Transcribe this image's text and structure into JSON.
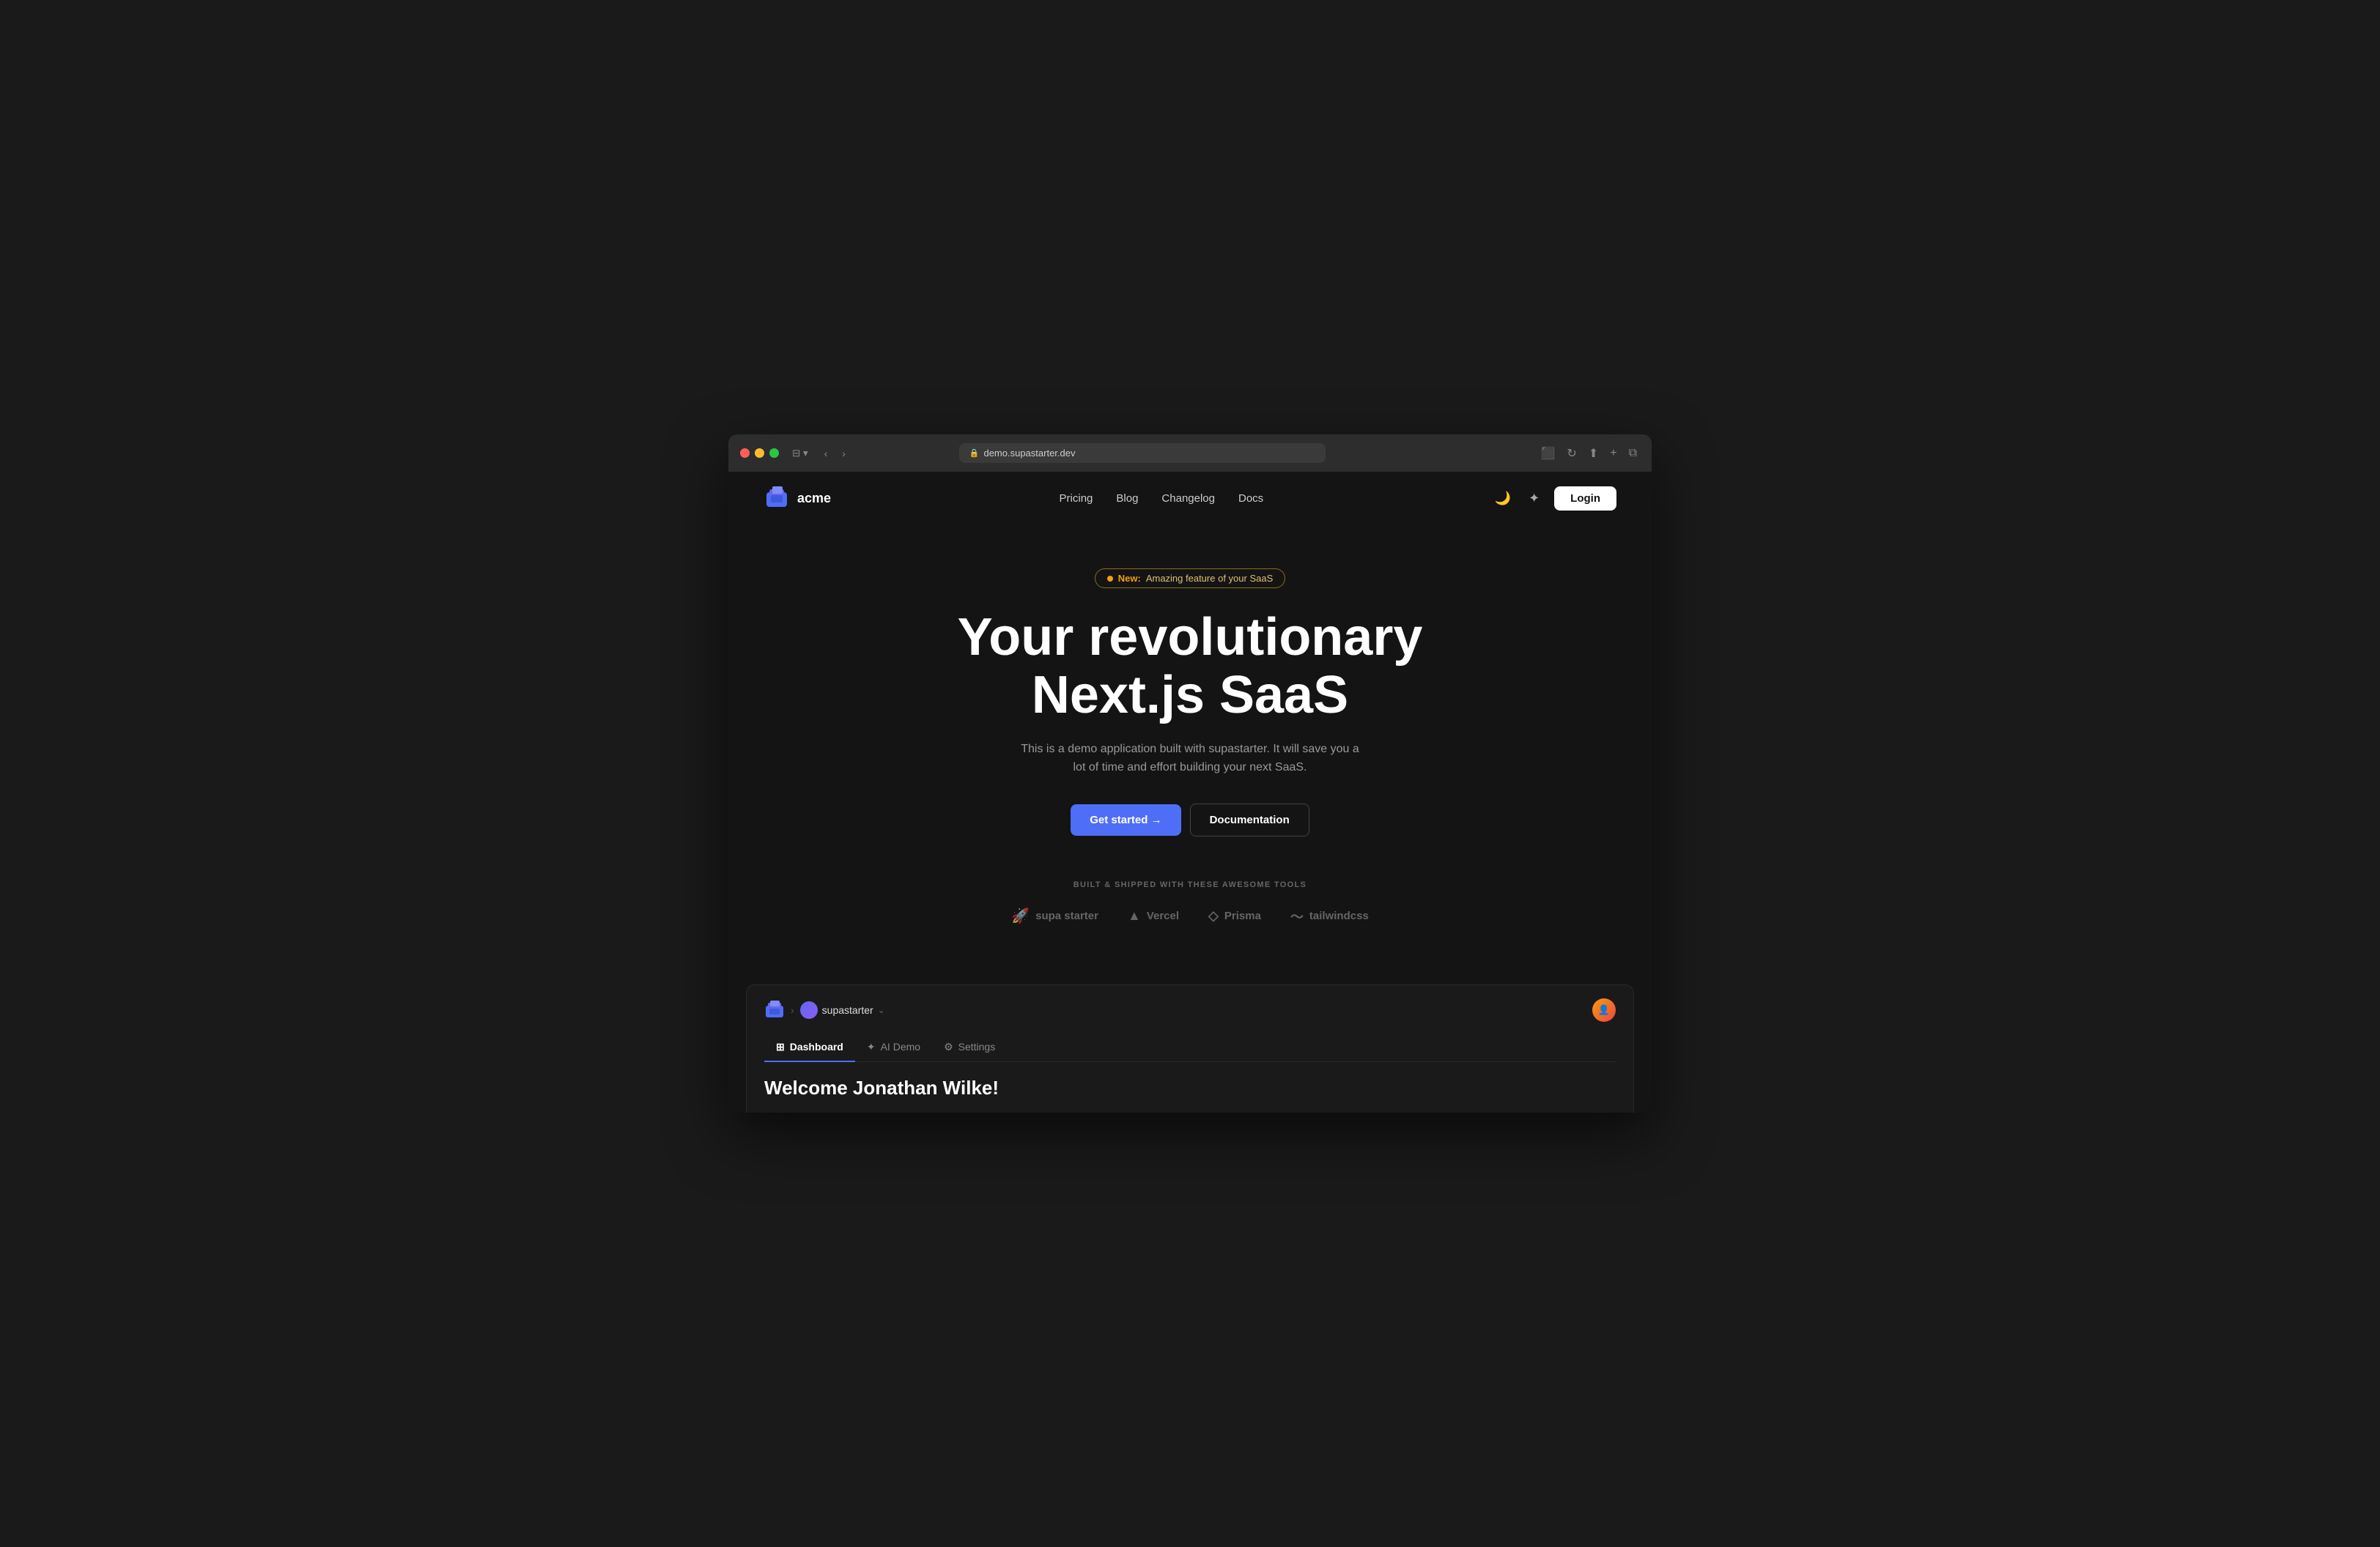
{
  "browser": {
    "url": "demo.supastarter.dev",
    "back_label": "‹",
    "forward_label": "›",
    "share_label": "⬆",
    "new_tab_label": "+",
    "tabs_label": "⧉",
    "reload_label": "↻",
    "lock_icon": "🔒"
  },
  "navbar": {
    "logo_text": "acme",
    "nav_links": [
      {
        "label": "Pricing",
        "id": "pricing"
      },
      {
        "label": "Blog",
        "id": "blog"
      },
      {
        "label": "Changelog",
        "id": "changelog"
      },
      {
        "label": "Docs",
        "id": "docs"
      }
    ],
    "login_label": "Login",
    "dark_mode_icon": "🌙",
    "language_icon": "✦"
  },
  "hero": {
    "badge_new": "New:",
    "badge_text": "Amazing feature of your SaaS",
    "title_line1": "Your revolutionary",
    "title_line2": "Next.js SaaS",
    "subtitle": "This is a demo application built with supastarter. It will save you a lot of time and effort building your next SaaS.",
    "get_started_label": "Get started →",
    "docs_label": "Documentation"
  },
  "tools": {
    "label": "BUILT & SHIPPED WITH THESE AWESOME TOOLS",
    "items": [
      {
        "name": "supa starter",
        "icon": "🚀"
      },
      {
        "name": "Vercel",
        "icon": "▲"
      },
      {
        "name": "Prisma",
        "icon": "◇"
      },
      {
        "name": "tailwindcss",
        "icon": "~"
      }
    ]
  },
  "dashboard": {
    "workspace_name": "supastarter",
    "tabs": [
      {
        "label": "Dashboard",
        "icon": "⊞",
        "active": true
      },
      {
        "label": "AI Demo",
        "icon": "✦",
        "active": false
      },
      {
        "label": "Settings",
        "icon": "⚙",
        "active": false
      }
    ],
    "welcome_text": "Welcome Jonathan Wilke!"
  }
}
